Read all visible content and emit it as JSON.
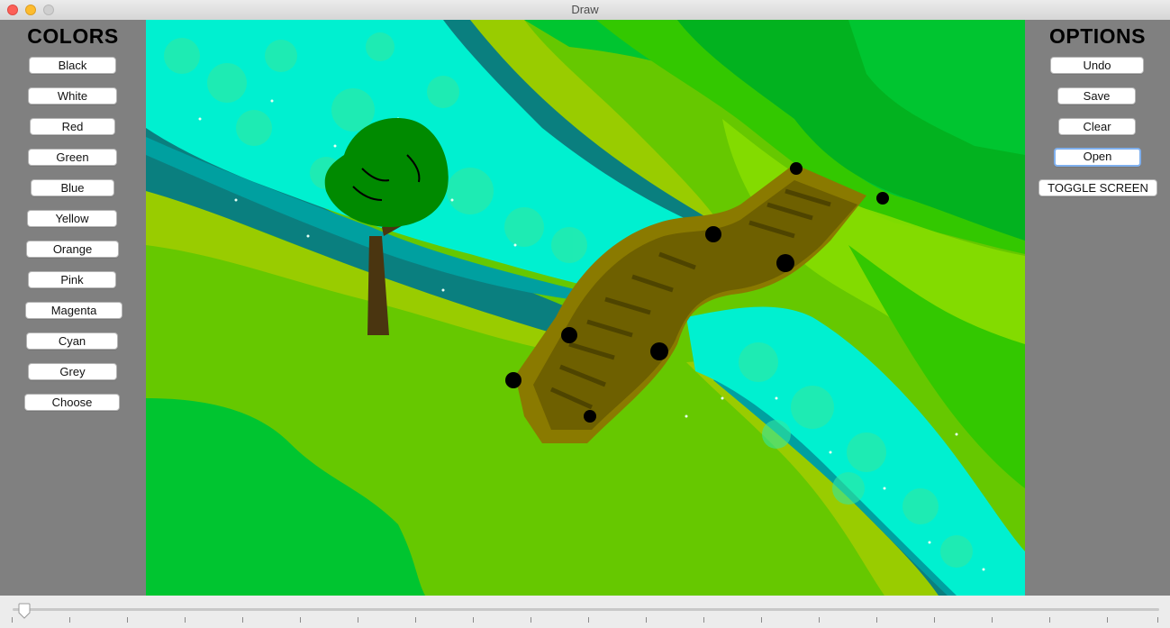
{
  "window": {
    "title": "Draw"
  },
  "colors_panel": {
    "title": "COLORS",
    "buttons": [
      "Black",
      "White",
      "Red",
      "Green",
      "Blue",
      "Yellow",
      "Orange",
      "Pink",
      "Magenta",
      "Cyan",
      "Grey",
      "Choose"
    ]
  },
  "options_panel": {
    "title": "OPTIONS",
    "buttons": [
      "Undo",
      "Save",
      "Clear",
      "Open",
      "TOGGLE SCREEN"
    ],
    "focused": "Open"
  },
  "brush_size_slider": {
    "value_fraction": 0.0
  }
}
